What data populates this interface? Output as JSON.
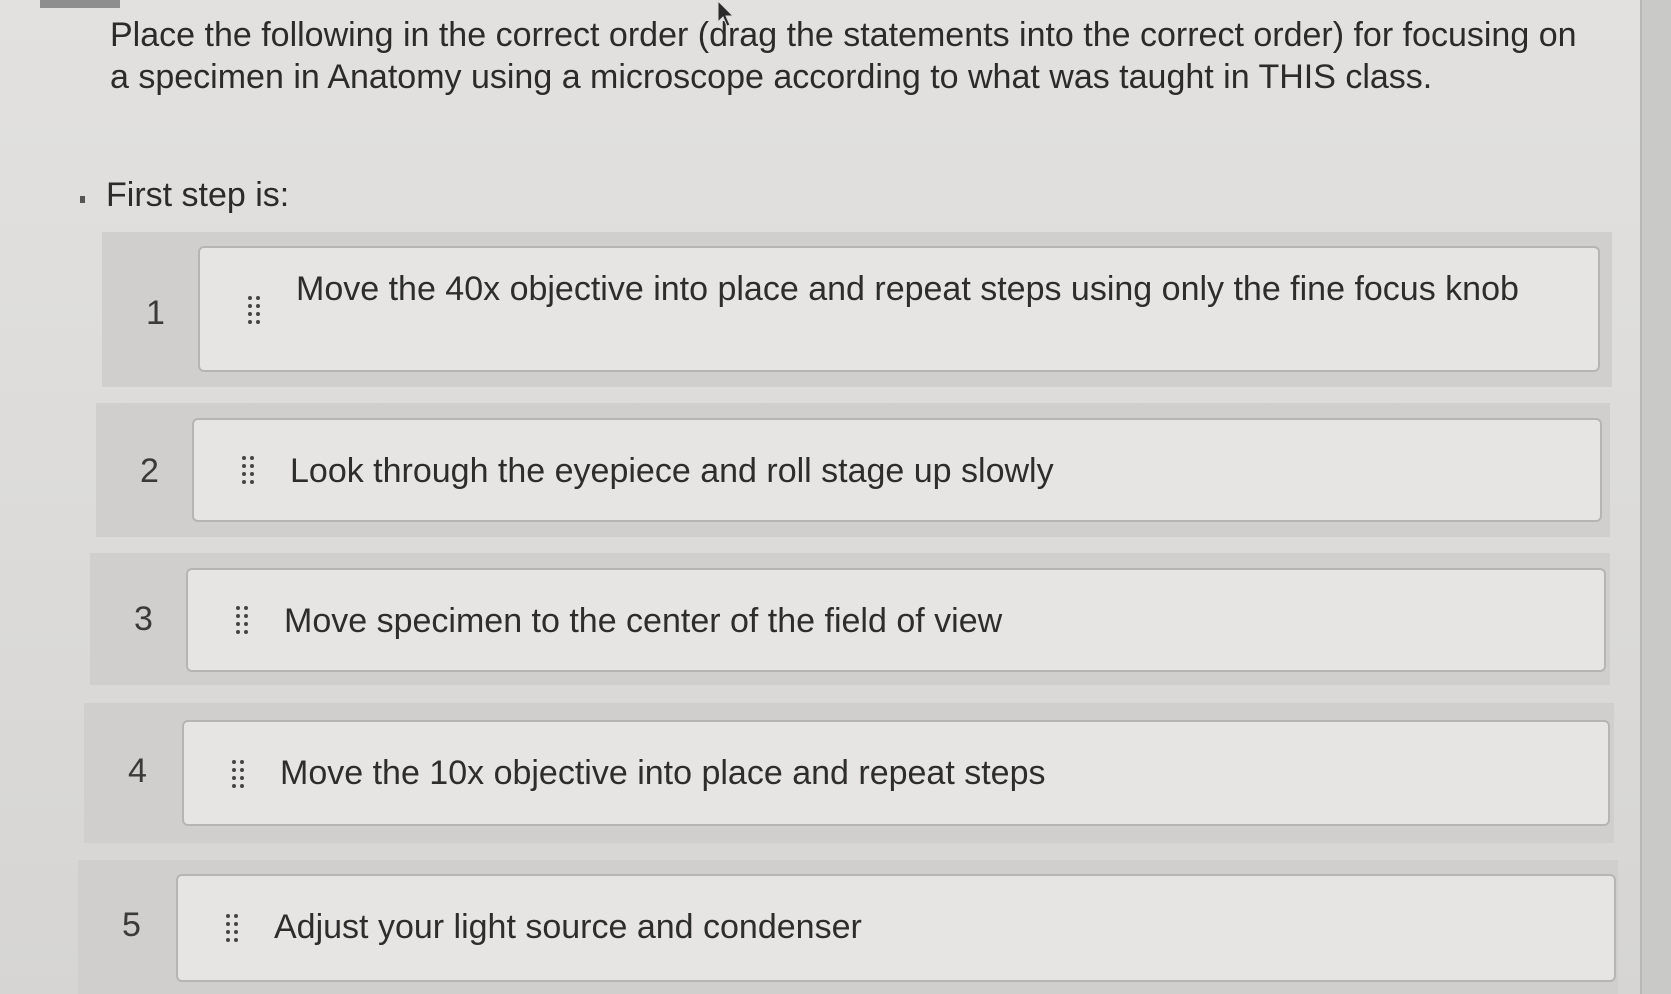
{
  "question": {
    "text": "Place the following in the correct order (drag the statements into the correct order) for focusing on a specimen in Anatomy using a microscope according to what was taught in THIS class.",
    "first_step_label": "First step is:"
  },
  "items": [
    {
      "number": "1",
      "text": "Move the 40x objective into place and repeat steps using only the fine focus knob",
      "icon": "drag-handle-icon"
    },
    {
      "number": "2",
      "text": "Look through the eyepiece and roll stage up slowly",
      "icon": "drag-handle-icon"
    },
    {
      "number": "3",
      "text": "Move specimen to the center of the field of view",
      "icon": "drag-handle-icon"
    },
    {
      "number": "4",
      "text": "Move the 10x objective into place and repeat steps",
      "icon": "drag-handle-icon"
    },
    {
      "number": "5",
      "text": "Adjust your light source and condenser",
      "icon": "drag-handle-icon"
    }
  ]
}
